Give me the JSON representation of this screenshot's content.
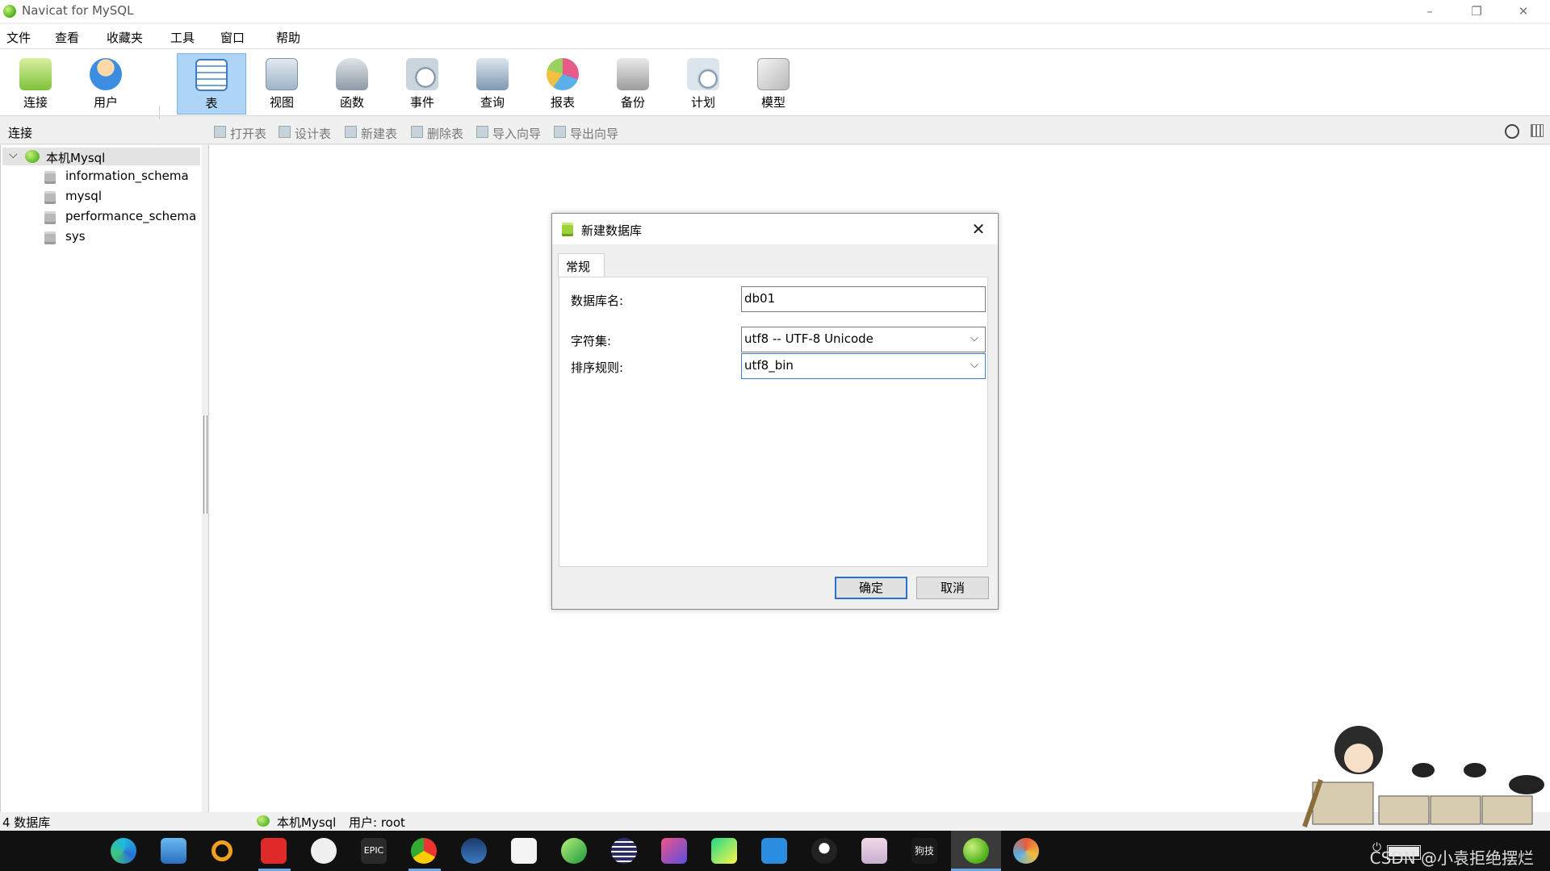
{
  "window": {
    "title": "Navicat for MySQL",
    "controls": [
      "–",
      "❐",
      "✕"
    ]
  },
  "menu": [
    "文件",
    "查看",
    "收藏夹",
    "工具",
    "窗口",
    "帮助"
  ],
  "toolbar": [
    {
      "label": "连接",
      "icon": "connect-icon"
    },
    {
      "label": "用户",
      "icon": "user-icon"
    },
    {
      "label": "表",
      "icon": "table-icon",
      "active": true
    },
    {
      "label": "视图",
      "icon": "view-icon"
    },
    {
      "label": "函数",
      "icon": "function-icon"
    },
    {
      "label": "事件",
      "icon": "event-icon"
    },
    {
      "label": "查询",
      "icon": "query-icon"
    },
    {
      "label": "报表",
      "icon": "report-icon"
    },
    {
      "label": "备份",
      "icon": "backup-icon"
    },
    {
      "label": "计划",
      "icon": "schedule-icon"
    },
    {
      "label": "模型",
      "icon": "model-icon"
    }
  ],
  "subbar": {
    "section_label": "连接",
    "actions": [
      "打开表",
      "设计表",
      "新建表",
      "删除表",
      "导入向导",
      "导出向导"
    ]
  },
  "tree": {
    "root": "本机Mysql",
    "databases": [
      "information_schema",
      "mysql",
      "performance_schema",
      "sys"
    ]
  },
  "dialog": {
    "title": "新建数据库",
    "tab": "常规",
    "fields": {
      "db_name_label": "数据库名:",
      "db_name_value": "db01",
      "charset_label": "字符集:",
      "charset_value": "utf8 -- UTF-8 Unicode",
      "collation_label": "排序规则:",
      "collation_value": "utf8_bin"
    },
    "ok_label": "确定",
    "cancel_label": "取消"
  },
  "status": {
    "db_count": "4 数据库",
    "connection": "本机Mysql",
    "user": "用户: root"
  },
  "taskbar": {
    "apps": [
      "edge-icon",
      "files-icon",
      "search-app-icon",
      "netease-music-icon",
      "wechat-icon",
      "epic-games-icon",
      "chrome-icon",
      "steam-icon",
      "thunder-icon",
      "green-app-icon",
      "eclipse-icon",
      "intellij-icon",
      "pycharm-icon",
      "vscode-icon",
      "qq-icon",
      "anime-app-icon",
      "mod-box-icon",
      "navicat-icon",
      "game-app-icon"
    ],
    "app_text": {
      "epic": "EPIC",
      "modbox": "狗技"
    },
    "battery": "100%",
    "watermark": "CSDN @小袁拒绝摆烂"
  }
}
